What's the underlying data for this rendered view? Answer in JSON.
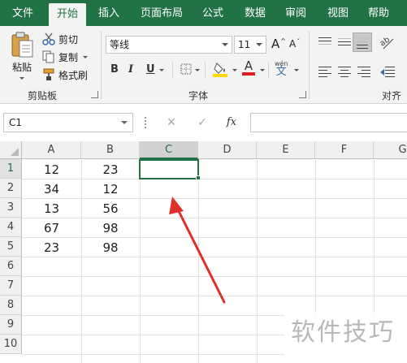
{
  "tabs": [
    {
      "label": "文件",
      "active": false
    },
    {
      "label": "开始",
      "active": true
    },
    {
      "label": "插入",
      "active": false
    },
    {
      "label": "页面布局",
      "active": false
    },
    {
      "label": "公式",
      "active": false
    },
    {
      "label": "数据",
      "active": false
    },
    {
      "label": "审阅",
      "active": false
    },
    {
      "label": "视图",
      "active": false
    },
    {
      "label": "帮助",
      "active": false
    }
  ],
  "clipboard": {
    "paste_label": "粘贴",
    "cut_label": "剪切",
    "copy_label": "复制",
    "format_painter_label": "格式刷",
    "group_label": "剪贴板"
  },
  "font": {
    "font_name": "等线",
    "font_size": "11",
    "bold": "B",
    "italic": "I",
    "underline": "U",
    "grow": "A",
    "shrink": "A",
    "font_color_letter": "A",
    "phonetic": "wén",
    "phonetic_char": "文",
    "group_label": "字体",
    "font_color": "#e02020",
    "fill_color": "#ffd800"
  },
  "alignment": {
    "group_label": "对齐方"
  },
  "formula_bar": {
    "name_box": "C1",
    "fx": "fx",
    "cancel": "✕",
    "enter": "✓",
    "formula": ""
  },
  "sheet": {
    "columns": [
      "A",
      "B",
      "C",
      "D",
      "E",
      "F",
      "G"
    ],
    "rows": [
      "1",
      "2",
      "3",
      "4",
      "5",
      "6",
      "7",
      "8",
      "9",
      "10"
    ],
    "selected_cell": "C1",
    "col_a": [
      "12",
      "34",
      "13",
      "67",
      "23"
    ],
    "col_b": [
      "23",
      "12",
      "56",
      "98",
      "98"
    ]
  },
  "watermark": "软件技巧",
  "accent_color": "#217346",
  "arrow_color": "#e0302a"
}
